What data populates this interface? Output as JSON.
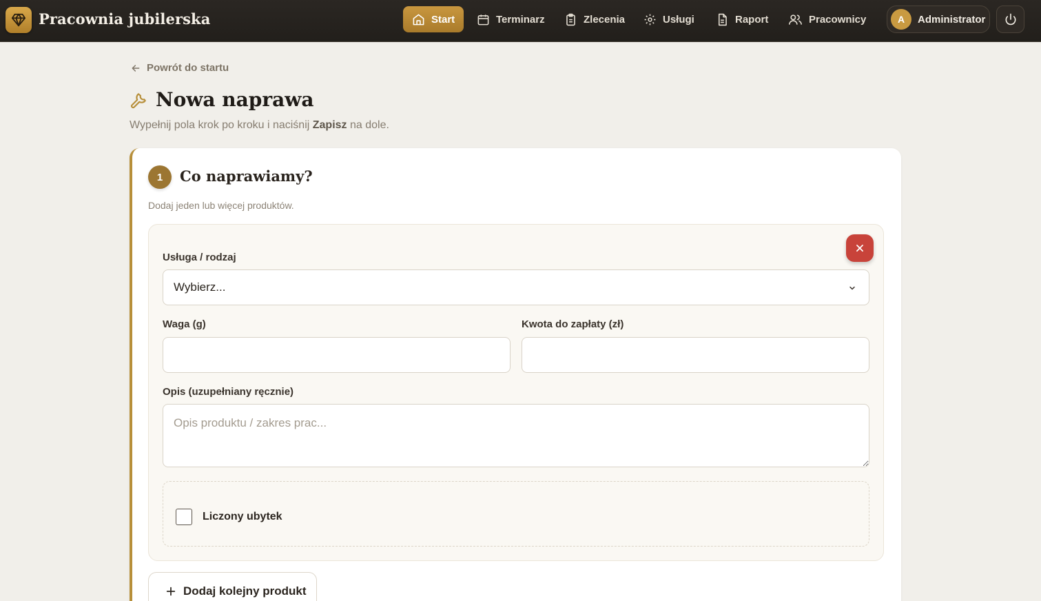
{
  "app": {
    "title": "Pracownia jubilerska"
  },
  "nav": {
    "items": [
      {
        "label": "Start",
        "icon": "home-icon",
        "active": true
      },
      {
        "label": "Terminarz",
        "icon": "calendar-icon"
      },
      {
        "label": "Zlecenia",
        "icon": "clipboard-icon"
      },
      {
        "label": "Usługi",
        "icon": "gear-icon"
      },
      {
        "label": "Raport",
        "icon": "document-icon"
      },
      {
        "label": "Pracownicy",
        "icon": "users-icon"
      }
    ],
    "user": {
      "initial": "A",
      "name": "Administrator"
    }
  },
  "page": {
    "back_label": "Powrót do startu",
    "title": "Nowa naprawa",
    "subtitle_pre": "Wypełnij pola krok po kroku i naciśnij ",
    "subtitle_bold": "Zapisz",
    "subtitle_post": " na dole."
  },
  "step1": {
    "number": "1",
    "title": "Co naprawiamy?",
    "description": "Dodaj jeden lub więcej produktów.",
    "product": {
      "service_label": "Usługa / rodzaj",
      "service_value": "Wybierz...",
      "weight_label": "Waga (g)",
      "weight_value": "",
      "amount_label": "Kwota do zapłaty (zł)",
      "amount_value": "",
      "desc_label": "Opis (uzupełniany ręcznie)",
      "desc_placeholder": "Opis produktu / zakres prac...",
      "loss_label": "Liczony ubytek",
      "loss_checked": false
    },
    "add_product_label": "Dodaj kolejny produkt"
  },
  "colors": {
    "accent": "#b78f3a",
    "nav_bg": "#262220",
    "danger": "#c8433a"
  }
}
